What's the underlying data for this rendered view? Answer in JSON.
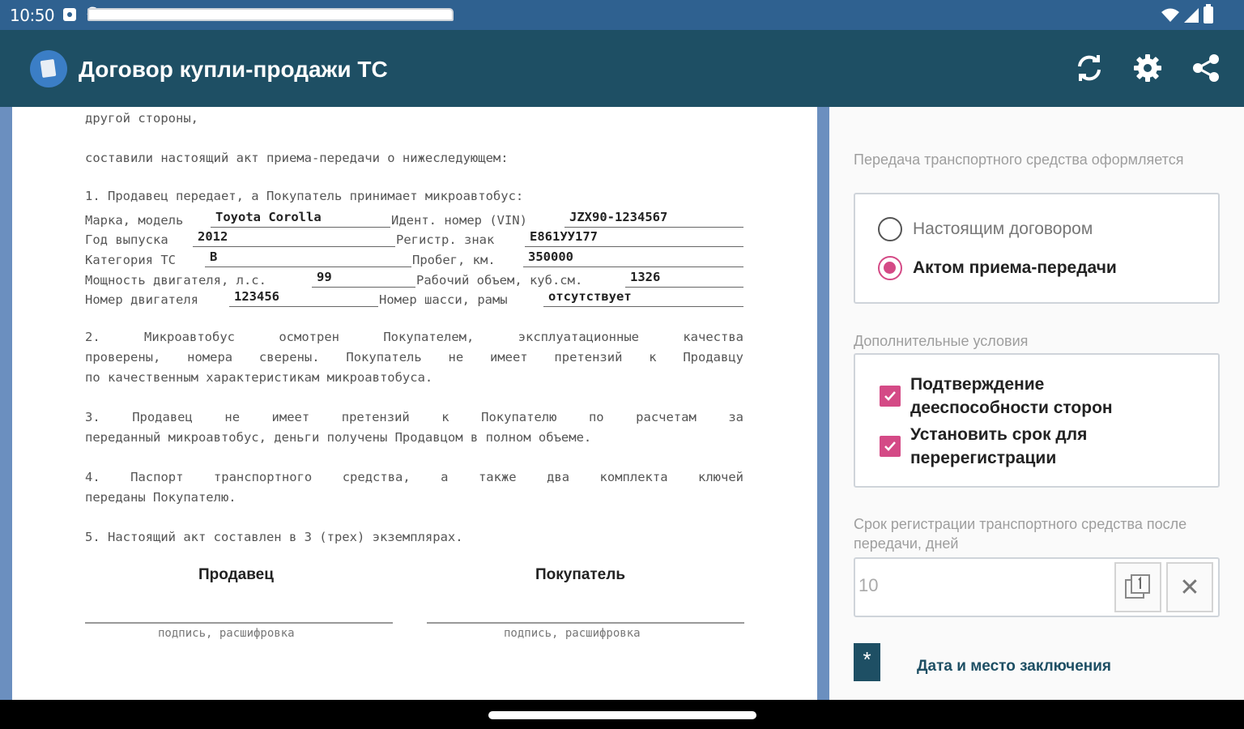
{
  "status_bar": {
    "time": "10:50",
    "icons": [
      "notification-icon",
      "sd-card-icon",
      "s-icon",
      "wifi-icon",
      "signal-icon",
      "battery-icon"
    ]
  },
  "app_bar": {
    "title": "Договор купли-продажи ТС",
    "actions": [
      "refresh-icon",
      "gear-icon",
      "share-icon"
    ]
  },
  "document": {
    "line_top": "другой стороны,",
    "intro": "составили настоящий акт приема-передачи о нижеследующем:",
    "item1": "1. Продавец передает, а Покупатель принимает микроавтобус:",
    "fields": {
      "make_label": "Марка, модель",
      "make": "Toyota Corolla",
      "vin_label": "Идент. номер (VIN)",
      "vin": "JZX90-1234567",
      "year_label": "Год выпуска",
      "year": "2012",
      "reg_label": "Регистр. знак",
      "reg": "Е861УУ177",
      "cat_label": "Категория ТС",
      "cat": "B",
      "mileage_label": "Пробег, км.",
      "mileage": "350000",
      "power_label": "Мощность двигателя, л.с.",
      "power": "99",
      "volume_label": "Рабочий объем, куб.см.",
      "volume": "1326",
      "engine_label": "Номер двигателя",
      "engine": "123456",
      "chassis_label": "Номер шасси, рамы",
      "chassis": "отсутствует"
    },
    "item2": [
      "2. Микроавтобус осмотрен Покупателем, эксплуатационные качества",
      "проверены, номера сверены. Покупатель не имеет претензий к Продавцу",
      "по качественным характеристикам микроавтобуса."
    ],
    "item3": [
      "3. Продавец не имеет претензий к Покупателю по расчетам за",
      "переданный микроавтобус, деньги получены Продавцом в полном объеме."
    ],
    "item4": [
      "4. Паспорт транспортного средства, а также два комплекта ключей",
      "переданы Покупателю."
    ],
    "item5": "5. Настоящий акт составлен в 3 (трех) экземплярах.",
    "seller": "Продавец",
    "buyer": "Покупатель",
    "sig_caption": "подпись, расшифровка"
  },
  "settings": {
    "transfer_label": "Передача транспортного средства оформляется",
    "options": [
      {
        "label": "Настоящим договором",
        "selected": false
      },
      {
        "label": "Актом приема-передачи",
        "selected": true
      }
    ],
    "extra_label": "Дополнительные условия",
    "checks": [
      {
        "label": "Подтверждение дееспособности сторон",
        "checked": true
      },
      {
        "label": "Установить срок для перерегистрации",
        "checked": true
      }
    ],
    "term_label": "Срок регистрации транспортного средства после передачи, дней",
    "term_value": "10",
    "date_link": "Дата и место заключения"
  },
  "colors": {
    "status_bar": "#2f6190",
    "app_bar": "#1e4f64",
    "accent": "#d44a86",
    "doc_border": "#6b8fbf"
  }
}
